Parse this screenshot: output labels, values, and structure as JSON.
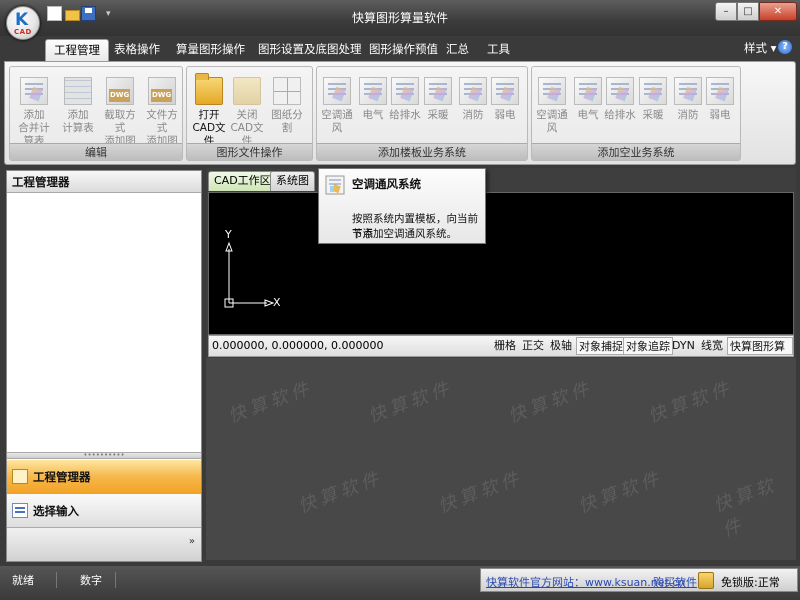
{
  "window": {
    "title": "快算图形算量软件",
    "controls": {
      "minimize": "–",
      "maximize": "□",
      "close": "✕"
    }
  },
  "quick_access": {
    "menu_glyph": "▾"
  },
  "ribbon": {
    "tabs": [
      "工程管理",
      "表格操作",
      "算量图形操作",
      "图形设置及底图处理",
      "图形操作预值",
      "汇总",
      "工具"
    ],
    "active_tab": "工程管理",
    "style_menu": "样式 ▾",
    "help": "?",
    "groups": [
      {
        "title": "编辑",
        "buttons": [
          {
            "line1": "添加",
            "line2": "合并计算表",
            "icon": "doc-icon"
          },
          {
            "line1": "添加",
            "line2": "计算表",
            "icon": "grid-icon"
          },
          {
            "line1": "截取方式",
            "line2": "添加图纸",
            "icon": "dwg-icon",
            "badge": "DWG"
          },
          {
            "line1": "文件方式",
            "line2": "添加图纸",
            "icon": "dwg-icon",
            "badge": "DWG"
          }
        ]
      },
      {
        "title": "图形文件操作",
        "buttons": [
          {
            "line1": "打开",
            "line2": "CAD文件",
            "icon": "folder-open-icon"
          },
          {
            "line1": "关闭",
            "line2": "CAD文件",
            "icon": "folder-closed-icon"
          },
          {
            "line1": "图纸分割",
            "line2": "",
            "icon": "split-icon"
          }
        ]
      },
      {
        "title": "添加楼板业务系统",
        "buttons": [
          {
            "line1": "空调通风",
            "icon": "doc-icon"
          },
          {
            "line1": "电气",
            "icon": "doc-icon"
          },
          {
            "line1": "给排水",
            "icon": "doc-icon"
          },
          {
            "line1": "采暖",
            "icon": "doc-icon"
          },
          {
            "line1": "消防",
            "icon": "doc-icon"
          },
          {
            "line1": "弱电",
            "icon": "doc-icon"
          }
        ]
      },
      {
        "title": "添加空业务系统",
        "buttons": [
          {
            "line1": "空调通风",
            "icon": "doc-icon"
          },
          {
            "line1": "电气",
            "icon": "doc-icon"
          },
          {
            "line1": "给排水",
            "icon": "doc-icon"
          },
          {
            "line1": "采暖",
            "icon": "doc-icon"
          },
          {
            "line1": "消防",
            "icon": "doc-icon"
          },
          {
            "line1": "弱电",
            "icon": "doc-icon"
          }
        ]
      }
    ]
  },
  "left_panel": {
    "header": "工程管理器",
    "nav": [
      {
        "label": "工程管理器",
        "icon": "folder-icon",
        "active": true
      },
      {
        "label": "选择输入",
        "icon": "list-icon",
        "active": false
      }
    ],
    "splitter_glyph": "••••••••••",
    "chevron": "»"
  },
  "cad": {
    "tabs": [
      "CAD工作区",
      "系统图"
    ],
    "active_tab": "CAD工作区",
    "axis_x": "X",
    "axis_y": "Y",
    "coordinates": "0.000000,  0.000000,  0.000000",
    "status_buttons": [
      {
        "label": "栅格",
        "on": false
      },
      {
        "label": "正交",
        "on": false
      },
      {
        "label": "极轴",
        "on": false
      },
      {
        "label": "对象捕捉",
        "on": true
      },
      {
        "label": "对象追踪",
        "on": true
      },
      {
        "label": "DYN",
        "on": false
      },
      {
        "label": "线宽",
        "on": false
      },
      {
        "label": "快算图形算量",
        "on": true
      }
    ],
    "watermark": "快算软件"
  },
  "tooltip": {
    "title": "空调通风系统",
    "line1": "按照系统内置模板，向当前节点",
    "line2": "下添加空调通风系统。"
  },
  "statusbar": {
    "ready": "就绪",
    "num": "数字",
    "site": "快算软件官方网站：www.ksuan.net.cn",
    "buy": "购买软件",
    "edition": "免锁版:正常"
  }
}
